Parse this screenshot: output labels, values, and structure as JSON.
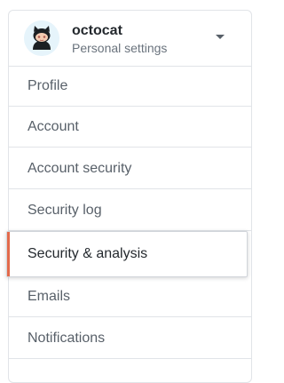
{
  "header": {
    "username": "octocat",
    "subtitle": "Personal settings",
    "avatar_icon": "octocat-icon",
    "dropdown_icon": "chevron-down-icon"
  },
  "menu": {
    "items": [
      {
        "label": "Profile",
        "selected": false
      },
      {
        "label": "Account",
        "selected": false
      },
      {
        "label": "Account security",
        "selected": false
      },
      {
        "label": "Security log",
        "selected": false
      },
      {
        "label": "Security & analysis",
        "selected": true
      },
      {
        "label": "Emails",
        "selected": false
      },
      {
        "label": "Notifications",
        "selected": false
      }
    ]
  },
  "colors": {
    "accent": "#e36a4b",
    "text": "#586069",
    "text_selected": "#24292e",
    "border": "#e1e4e8"
  }
}
